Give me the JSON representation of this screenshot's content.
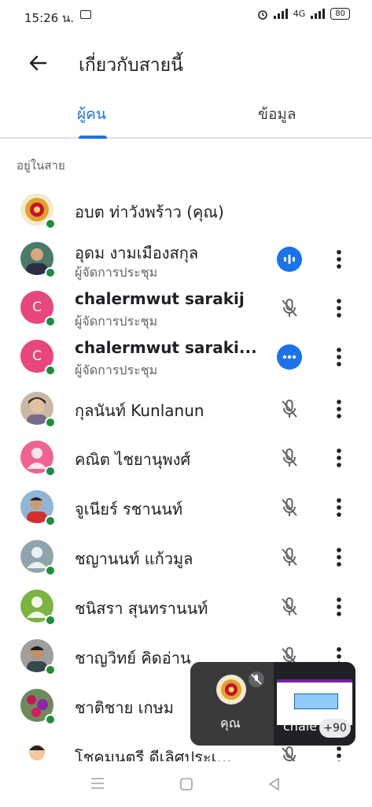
{
  "status_bar": {
    "time": "15:26 น.",
    "network": "4G",
    "battery": "80"
  },
  "header": {
    "title": "เกี่ยวกับสายนี้"
  },
  "tabs": [
    {
      "label": "ผู้คน"
    },
    {
      "label": "ข้อมูล"
    }
  ],
  "section_label": "อยู่ในสาย",
  "participants": [
    {
      "name": "อบต ท่าวังพร้าว (คุณ)",
      "role": ""
    },
    {
      "name": "อุดม งามเมืองสกุล",
      "role": "ผู้จัดการประชุม",
      "indicator": "speaking"
    },
    {
      "name": "chalermwut sarakij",
      "role": "ผู้จัดการประชุม",
      "indicator": "muted"
    },
    {
      "name": "chalermwut saraki...",
      "role": "ผู้จัดการประชุม",
      "indicator": "more"
    },
    {
      "name": "กุลนันท์ Kunlanun",
      "role": "",
      "indicator": "muted"
    },
    {
      "name": "คณิต ไชยานุพงศ์",
      "role": "",
      "indicator": "muted"
    },
    {
      "name": "จูเนียร์ รชานนท์",
      "role": "",
      "indicator": "muted"
    },
    {
      "name": "ชญานนท์ แก้วมูล",
      "role": "",
      "indicator": "muted"
    },
    {
      "name": "ชนิสรา สุนทรานนท์",
      "role": "",
      "indicator": "muted"
    },
    {
      "name": "ชาญวิทย์ คิดอ่าน",
      "role": "",
      "indicator": "muted"
    },
    {
      "name": "ชาติชาย เกษม",
      "role": "",
      "indicator": "muted"
    },
    {
      "name": "โชคมนตรี ดีเลิศประเ...",
      "role": "",
      "indicator": "muted"
    }
  ],
  "avatar_letter": "C",
  "pip": {
    "self_label": "คุณ",
    "other_label": "chale",
    "more_count": "+90"
  },
  "colors": {
    "accent": "#1a73e8",
    "online": "#1e8e3e",
    "letter_avatar": "#e8467c"
  }
}
